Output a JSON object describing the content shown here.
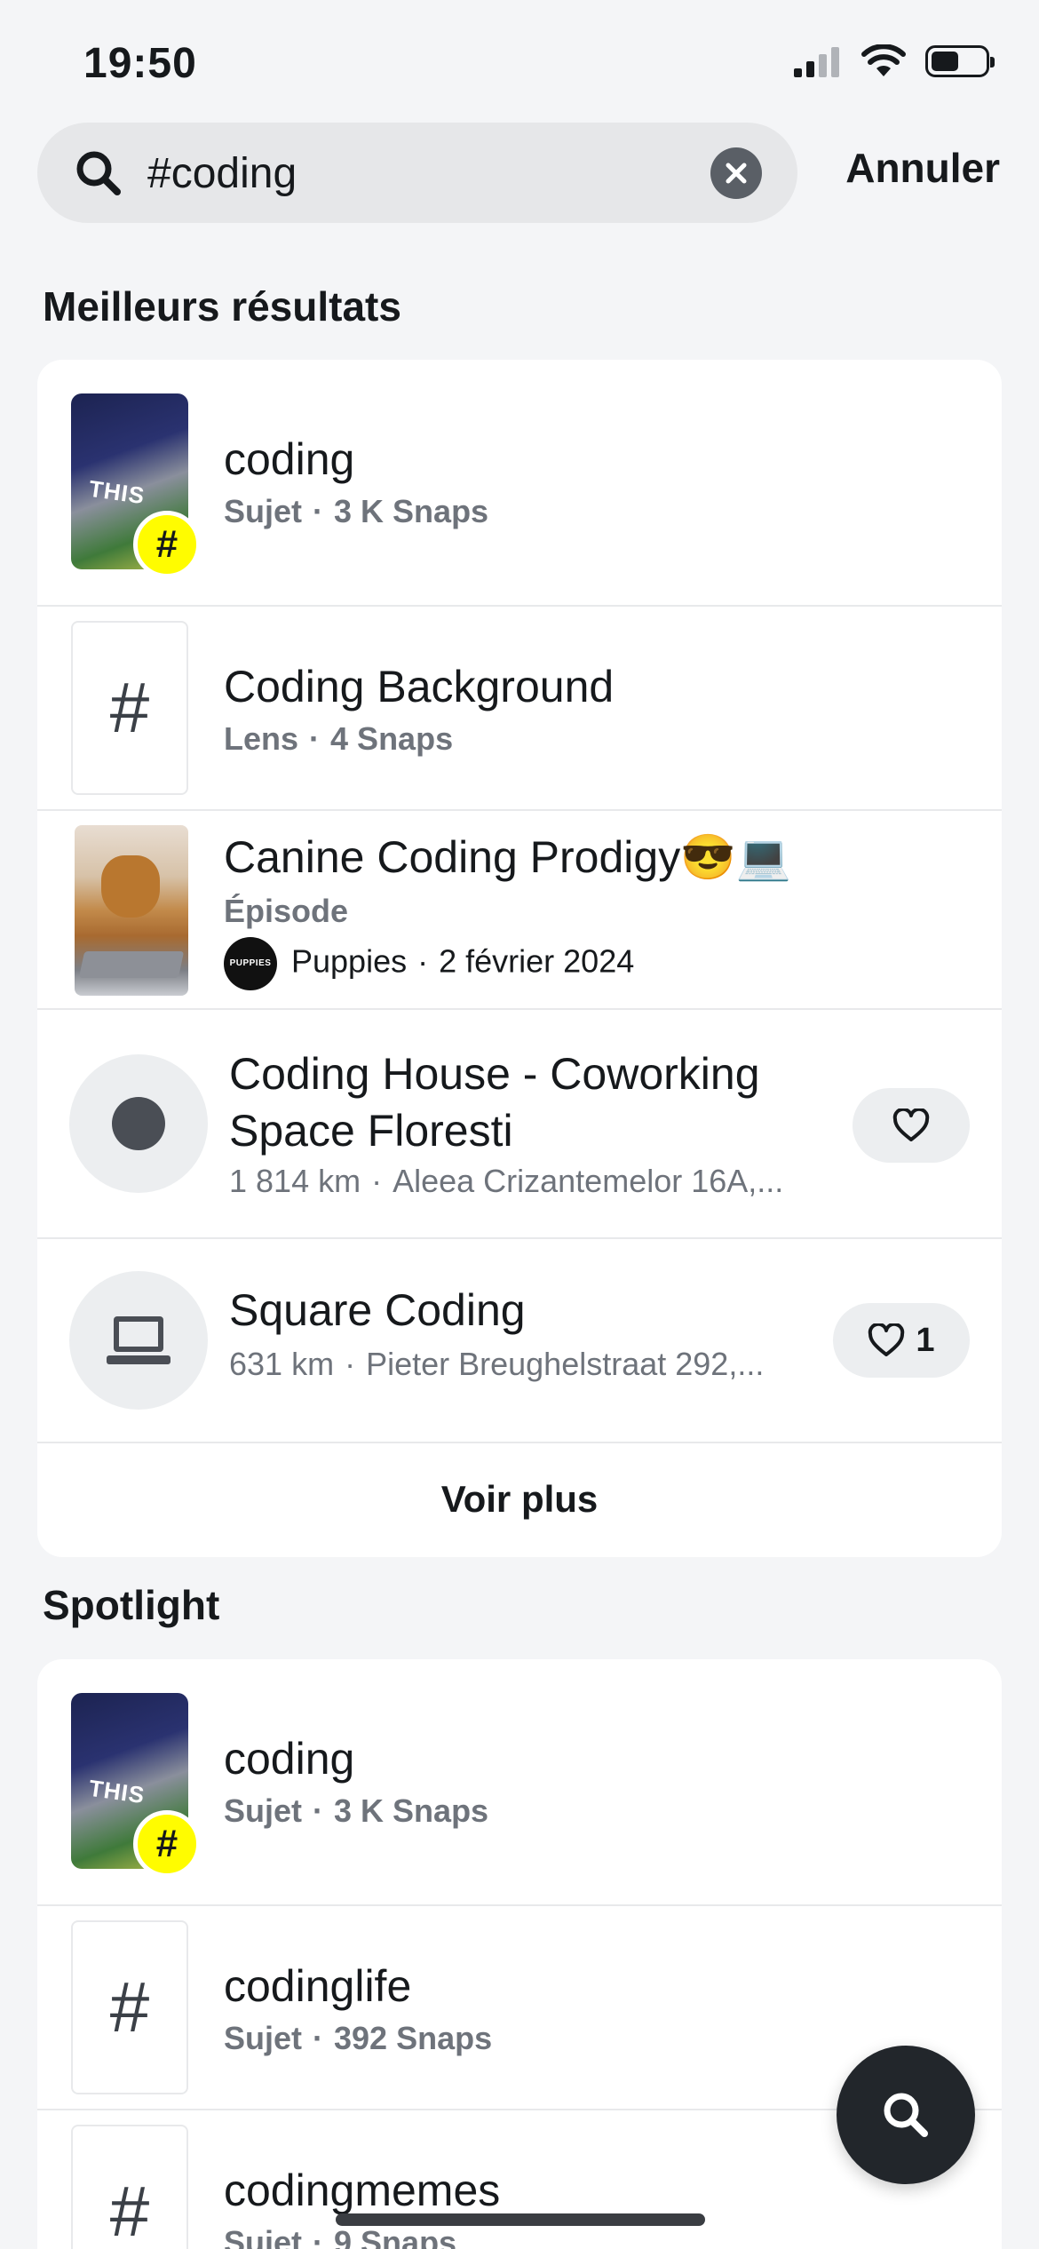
{
  "status_bar": {
    "time": "19:50"
  },
  "search": {
    "value": "#coding",
    "cancel_label": "Annuler"
  },
  "best_results": {
    "title": "Meilleurs résultats",
    "items": [
      {
        "title": "coding",
        "type": "Sujet",
        "meta": "3 K Snaps",
        "icon": "hashtag-icon"
      },
      {
        "title": "Coding Background",
        "type": "Lens",
        "meta": "4 Snaps",
        "icon": "hashtag-icon"
      },
      {
        "title": "Canine Coding Prodigy😎💻",
        "type": "Épisode",
        "publisher_avatar": "PUPPIES",
        "publisher": "Puppies",
        "date": "2 février 2024"
      },
      {
        "title": "Coding House - Coworking Space Floresti",
        "distance": "1 814 km",
        "address": "Aleea Crizantemelor 16A,...",
        "icon": "place-dot-icon"
      },
      {
        "title": "Square Coding",
        "distance": "631 km",
        "address": "Pieter Breughelstraat 292,...",
        "favorites": "1",
        "icon": "laptop-icon"
      }
    ],
    "see_more_label": "Voir plus"
  },
  "spotlight": {
    "title": "Spotlight",
    "items": [
      {
        "title": "coding",
        "type": "Sujet",
        "meta": "3 K Snaps"
      },
      {
        "title": "codinglife",
        "type": "Sujet",
        "meta": "392 Snaps"
      },
      {
        "title": "codingmemes",
        "type": "Sujet",
        "meta": "9 Snaps"
      }
    ]
  },
  "thumbnail_overlay_text": "THIS",
  "hash_symbol": "#",
  "colors": {
    "accent_yellow": "#fffc00",
    "background": "#f4f5f7",
    "fab": "#22262b"
  }
}
